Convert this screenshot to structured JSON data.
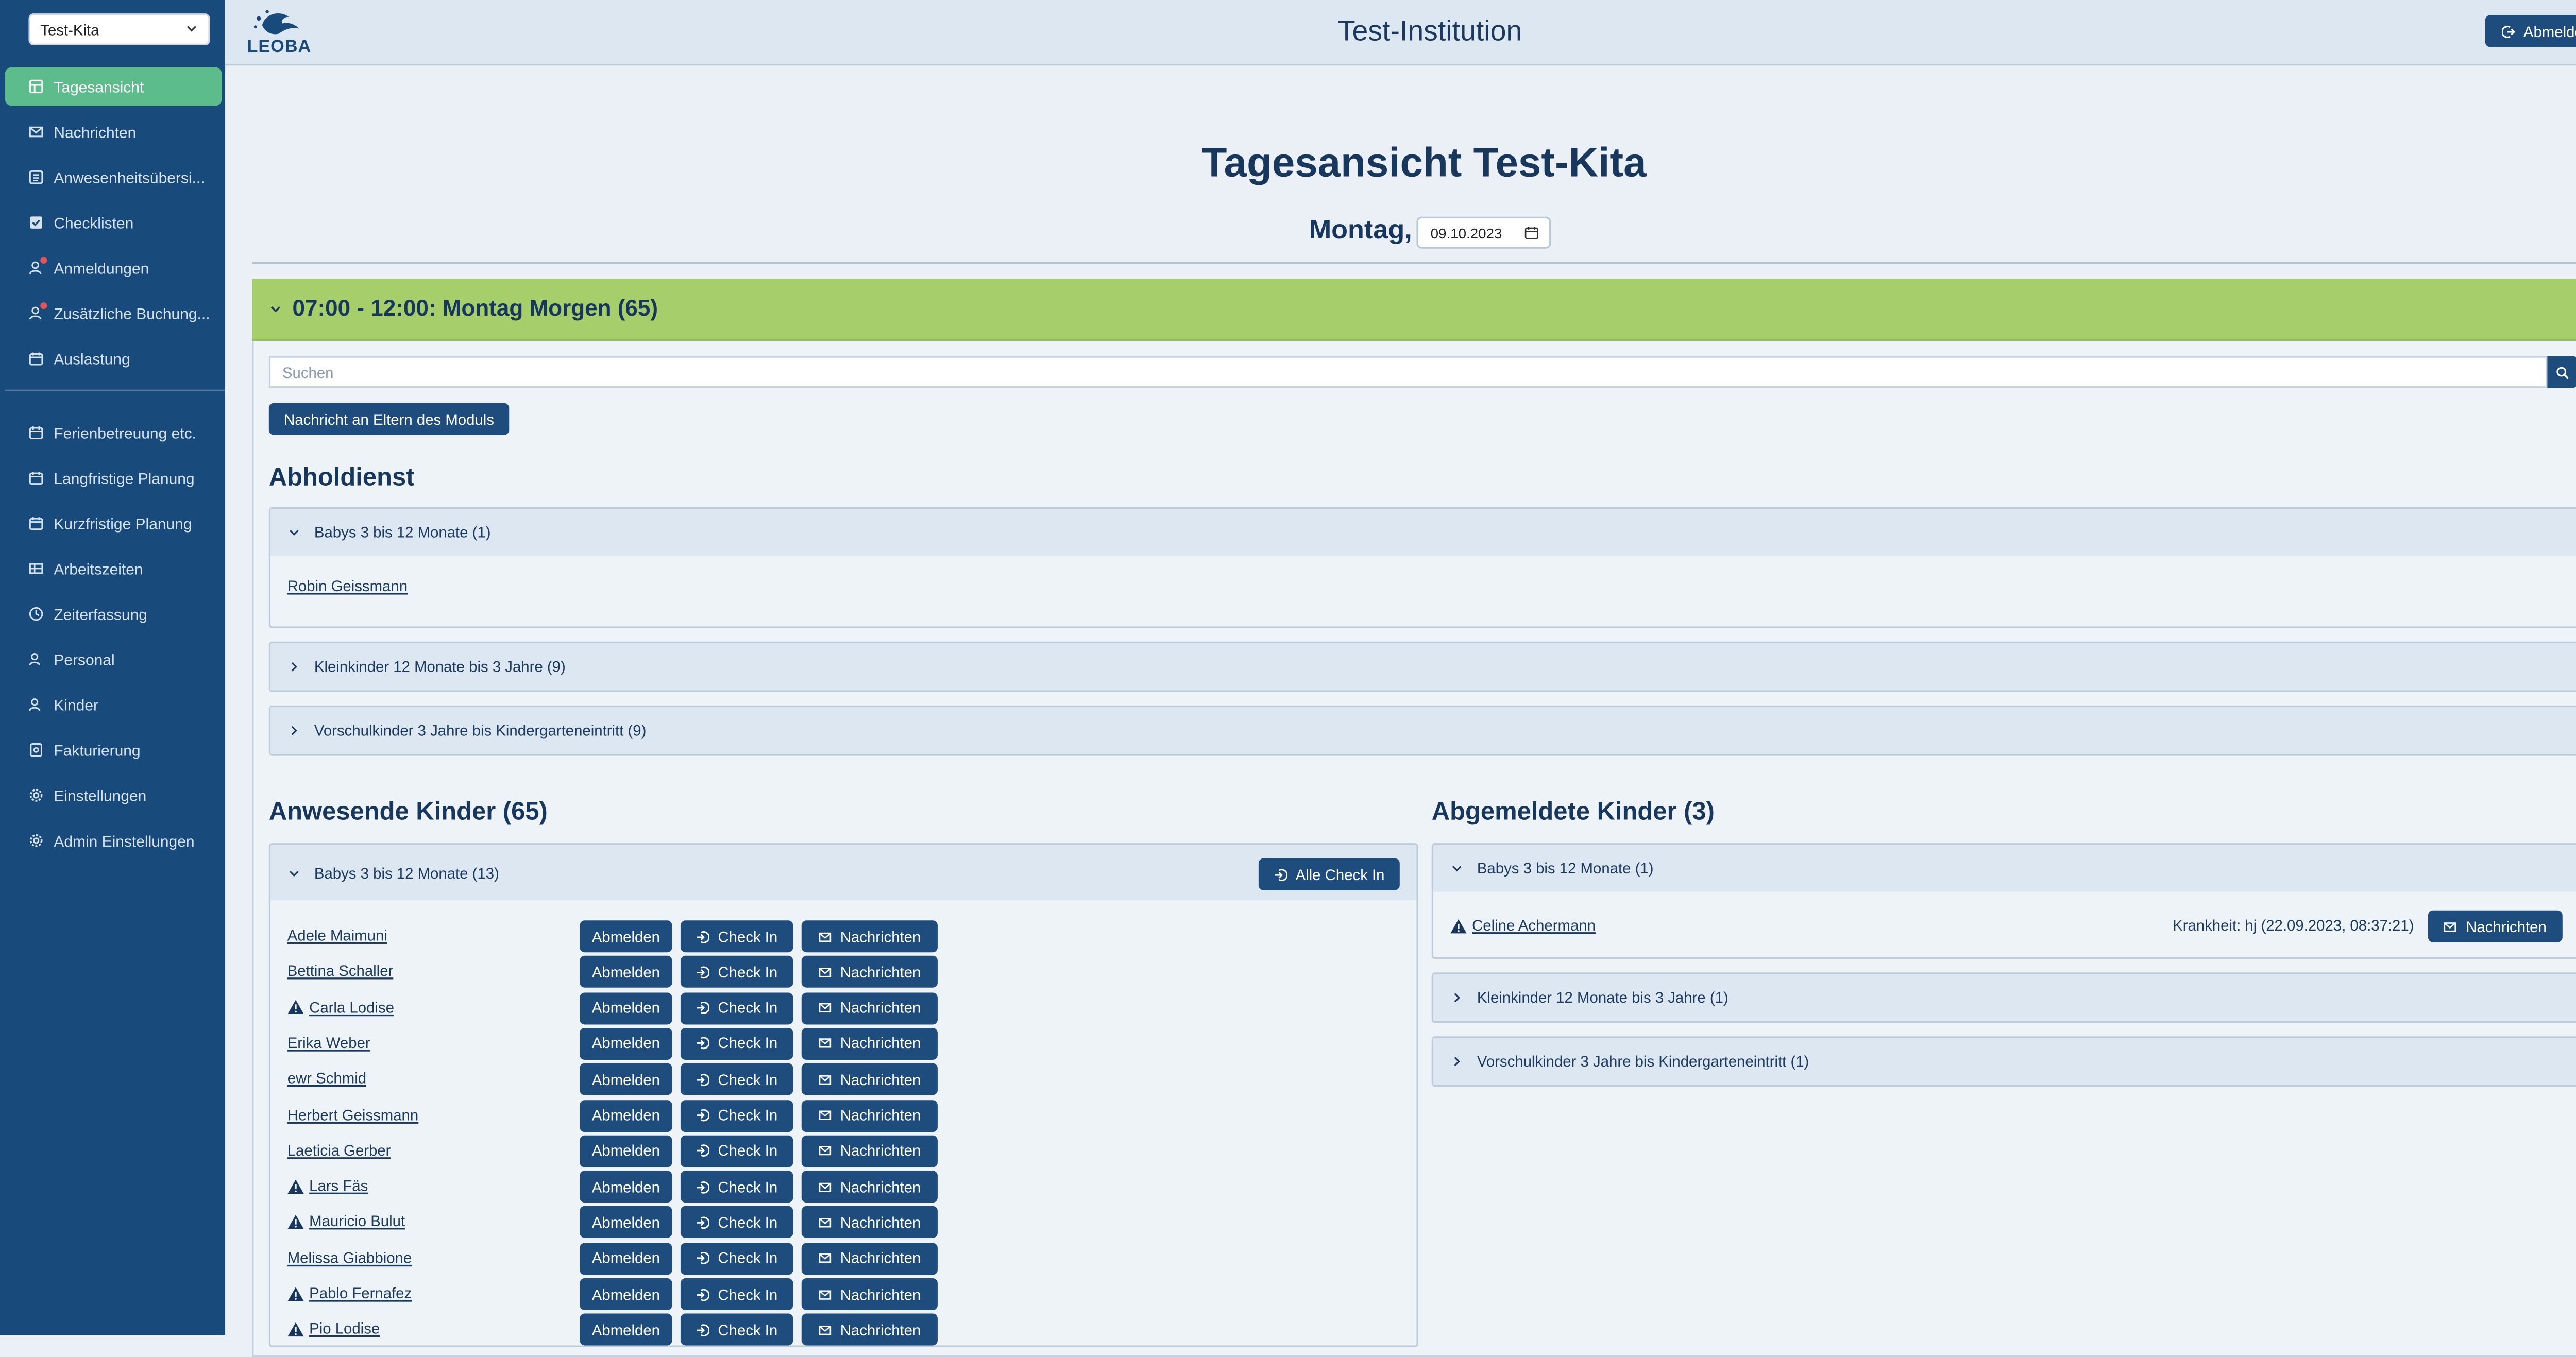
{
  "sidebar": {
    "kita_select": "Test-Kita",
    "items": [
      {
        "label": "Tagesansicht",
        "icon": "dashboard-icon",
        "active": true
      },
      {
        "label": "Nachrichten",
        "icon": "mail-icon"
      },
      {
        "label": "Anwesenheitsübersi...",
        "icon": "list-icon"
      },
      {
        "label": "Checklisten",
        "icon": "checkbox-icon"
      },
      {
        "label": "Anmeldungen",
        "icon": "user-add-icon",
        "badge": true
      },
      {
        "label": "Zusätzliche Buchung...",
        "icon": "user-add-icon",
        "badge": true
      },
      {
        "label": "Auslastung",
        "icon": "calendar-icon"
      }
    ],
    "items2": [
      {
        "label": "Ferienbetreuung etc.",
        "icon": "calendar-icon"
      },
      {
        "label": "Langfristige Planung",
        "icon": "calendar-icon"
      },
      {
        "label": "Kurzfristige Planung",
        "icon": "calendar-icon"
      },
      {
        "label": "Arbeitszeiten",
        "icon": "table-icon"
      },
      {
        "label": "Zeiterfassung",
        "icon": "clock-icon"
      },
      {
        "label": "Personal",
        "icon": "users-icon"
      },
      {
        "label": "Kinder",
        "icon": "users-icon"
      },
      {
        "label": "Fakturierung",
        "icon": "invoice-icon"
      },
      {
        "label": "Einstellungen",
        "icon": "gear-icon"
      },
      {
        "label": "Admin Einstellungen",
        "icon": "gear-icon"
      }
    ]
  },
  "header": {
    "logo_text": "LEOBA",
    "institution": "Test-Institution",
    "logout": "Abmelden"
  },
  "page": {
    "title": "Tagesansicht Test-Kita",
    "weekday": "Montag,",
    "date": "09.10.2023"
  },
  "module": {
    "title": "07:00 - 12:00: Montag Morgen (65)",
    "search_placeholder": "Suchen",
    "notify_button": "Nachricht an Eltern des Moduls"
  },
  "pickup": {
    "heading": "Abholdienst",
    "groups": [
      {
        "label": "Babys 3 bis 12 Monate (1)",
        "expanded": true,
        "children": [
          "Robin Geissmann"
        ]
      },
      {
        "label": "Kleinkinder 12 Monate bis 3 Jahre (9)",
        "expanded": false
      },
      {
        "label": "Vorschulkinder 3 Jahre bis Kindergarteneintritt (9)",
        "expanded": false
      }
    ]
  },
  "present": {
    "heading": "Anwesende Kinder (65)",
    "group_label": "Babys 3 bis 12 Monate (13)",
    "all_checkin": "Alle Check In",
    "btn_abmelden": "Abmelden",
    "btn_checkin": "Check In",
    "btn_nachrichten": "Nachrichten",
    "children": [
      {
        "name": "Adele Maimuni",
        "warning": false
      },
      {
        "name": "Bettina Schaller",
        "warning": false
      },
      {
        "name": "Carla Lodise",
        "warning": true
      },
      {
        "name": "Erika Weber",
        "warning": false
      },
      {
        "name": "ewr Schmid",
        "warning": false
      },
      {
        "name": "Herbert Geissmann",
        "warning": false
      },
      {
        "name": "Laeticia Gerber",
        "warning": false
      },
      {
        "name": "Lars Fäs",
        "warning": true
      },
      {
        "name": "Mauricio Bulut",
        "warning": true
      },
      {
        "name": "Melissa Giabbione",
        "warning": false
      },
      {
        "name": "Pablo Fernafez",
        "warning": true
      },
      {
        "name": "Pio Lodise",
        "warning": true
      }
    ]
  },
  "absent": {
    "heading": "Abgemeldete Kinder (3)",
    "groups": [
      {
        "label": "Babys 3 bis 12 Monate (1)",
        "expanded": true
      },
      {
        "label": "Kleinkinder 12 Monate bis 3 Jahre (1)",
        "expanded": false
      },
      {
        "label": "Vorschulkinder 3 Jahre bis Kindergarteneintritt (1)",
        "expanded": false
      }
    ],
    "child": {
      "name": "Celine Achermann",
      "reason": "Krankheit: hj (22.09.2023, 08:37:21)",
      "button": "Nachrichten"
    }
  },
  "colors": {
    "sidebar": "#184a7c",
    "active_nav": "#5cbc8c",
    "module_header": "#a6cf6c",
    "button": "#1e4d7d"
  }
}
